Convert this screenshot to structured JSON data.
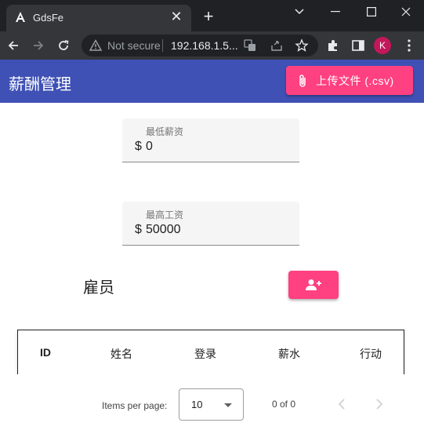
{
  "browser": {
    "tab_title": "GdsFe",
    "tab_close": "✕",
    "new_tab": "+",
    "security_label": "Not secure",
    "url": "192.168.1.5...",
    "profile_initial": "K"
  },
  "toolbar": {
    "title": "薪酬管理",
    "upload_label": "上传文件 (.csv)"
  },
  "filters": {
    "min_salary": {
      "label": "最低薪资",
      "prefix": "$",
      "value": "0"
    },
    "max_salary": {
      "label": "最高工资",
      "prefix": "$",
      "value": "50000"
    }
  },
  "employees": {
    "title": "雇员"
  },
  "table": {
    "columns": [
      "ID",
      "姓名",
      "登录",
      "薪水",
      "行动"
    ]
  },
  "paginator": {
    "items_per_page_label": "Items per page:",
    "page_size": "10",
    "range_label": "0 of 0"
  },
  "colors": {
    "primary": "#3f51b5",
    "accent": "#ff4081"
  },
  "icons": {
    "upload": "paperclip-icon",
    "add_user": "person-add-icon",
    "prev": "chevron-left-icon",
    "next": "chevron-right-icon"
  }
}
